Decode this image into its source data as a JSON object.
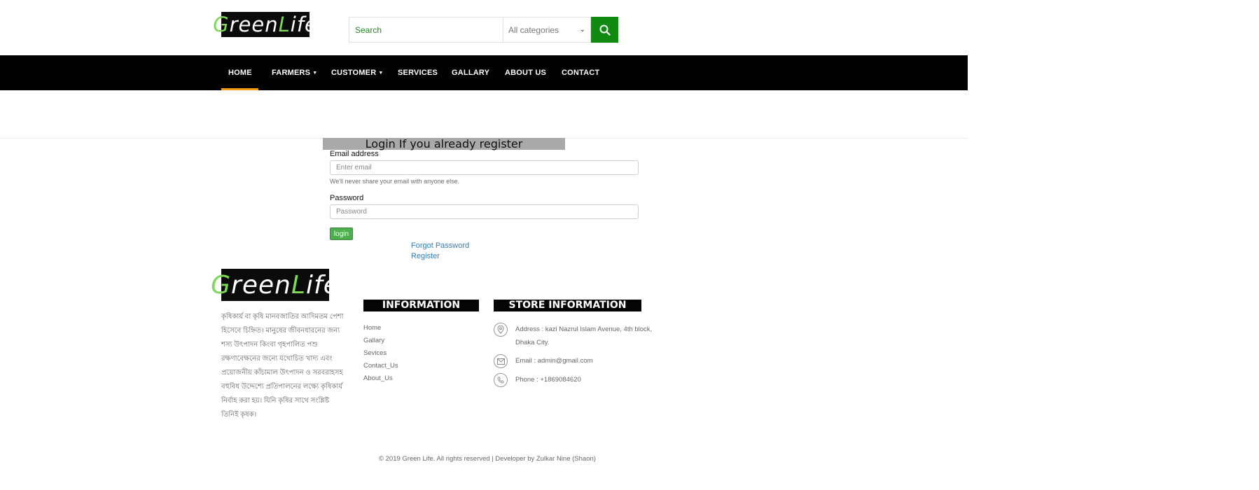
{
  "brand": {
    "logo_part1": "G",
    "logo_part2": "reen ",
    "logo_part3": "L",
    "logo_part4": "ife"
  },
  "search": {
    "placeholder": "Search",
    "category": "All categories"
  },
  "nav": {
    "items": [
      {
        "label": "HOME",
        "dropdown": false,
        "active": true
      },
      {
        "label": "FARMERS",
        "dropdown": true
      },
      {
        "label": "CUSTOMER",
        "dropdown": true
      },
      {
        "label": "SERVICES",
        "dropdown": false
      },
      {
        "label": "GALLARY",
        "dropdown": false
      },
      {
        "label": "ABOUT US",
        "dropdown": false
      },
      {
        "label": "CONTACT",
        "dropdown": false
      }
    ]
  },
  "login": {
    "title": "Login If you already register",
    "email_label": "Email address",
    "email_placeholder": "Enter email",
    "email_help": "We'll never share your email with anyone else.",
    "password_label": "Password",
    "password_placeholder": "Password",
    "button": "login",
    "forgot_link": "Forgot Password",
    "register_link": "Register"
  },
  "footer": {
    "about": "কৃষিকার্য বা কৃষি মানবজাতির আদিমতম পেশা হিসেবে চিহ্নিত। মানুষের জীবনধারনের জন্য শস্য উৎপাদন কিংবা গৃহপালিত পশু রক্ষণাবেক্ষনের জন্যে যথোচিত খাদ্য এবং প্রয়োজনীয় কাঁচামাল উৎপাদন ও সরবরাহসহ বহুবিধ উদ্দেশ্যে প্রতিপালনের লক্ষ্যে কৃষিকার্য নির্বাহ করা হয়। যিনি কৃষির সাথে সংশ্লিষ্ট তিনিই কৃষক।",
    "info_heading": "INFORMATION",
    "info_links": [
      "Home",
      "Gallary",
      "Sevices",
      "Contact_Us",
      "About_Us"
    ],
    "store_heading": "STORE INFORMATION",
    "store": {
      "address": "Address : kazi Nazrul Islam Avenue, 4th block, Dhaka City.",
      "email": "Email : admin@gmail.com",
      "phone": "Phone : +1869084620"
    },
    "copyright": "© 2019 Green Life. All rights reserved | Developer by Zulkar Nine (Shaon)"
  },
  "colors": {
    "accent_green": "#108a10",
    "nav_bg": "#020202",
    "nav_active": "#f39c12",
    "link_blue": "#337ab7"
  }
}
